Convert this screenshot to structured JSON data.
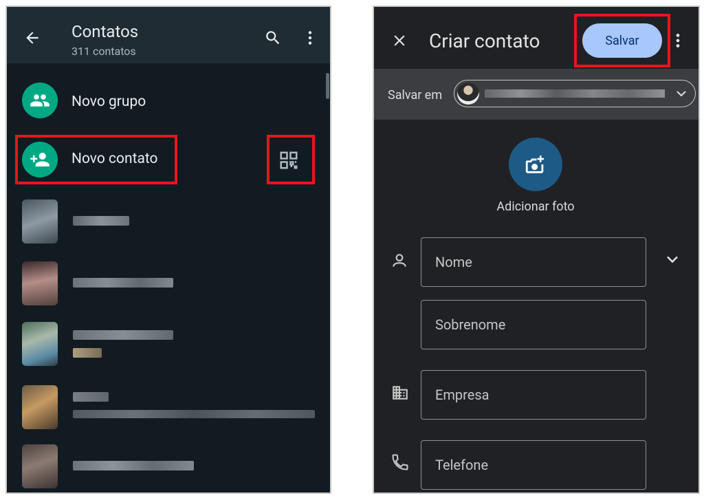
{
  "left": {
    "header": {
      "title": "Contatos",
      "subtitle": "311 contatos"
    },
    "actions": {
      "new_group": "Novo grupo",
      "new_contact": "Novo contato"
    },
    "contacts": [
      {
        "avatar": "#5e6d78",
        "lines": [
          "#8a939a"
        ]
      },
      {
        "avatar": "#a07a76",
        "lines": [
          "#8c9399"
        ]
      },
      {
        "avatar": "#7a8f8f",
        "lines": [
          "#7e878d",
          "#b7a98a"
        ]
      },
      {
        "avatar": "#9a7d62",
        "lines": [
          "#88909a",
          "#6c757c"
        ]
      },
      {
        "avatar": "#6f6460",
        "lines": [
          "#8b9297"
        ]
      }
    ],
    "colors": {
      "background": "#121b22",
      "header": "#1f2c34",
      "accent": "#00a884",
      "highlight": "#e8151b"
    }
  },
  "right": {
    "header": {
      "title": "Criar contato",
      "save_label": "Salvar"
    },
    "account": {
      "label": "Salvar em"
    },
    "photo": {
      "label": "Adicionar foto"
    },
    "fields": {
      "first_name": "Nome",
      "last_name": "Sobrenome",
      "company": "Empresa",
      "phone": "Telefone"
    },
    "colors": {
      "background": "#202124",
      "save_button": "#a8c7fa",
      "photo": "#1e5a86",
      "highlight": "#e8151b"
    }
  }
}
